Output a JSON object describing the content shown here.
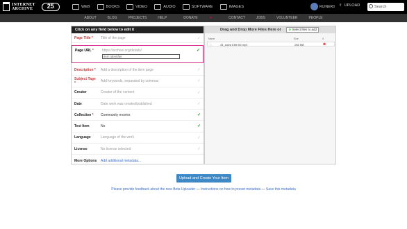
{
  "header": {
    "logo_line1": "INTERNET",
    "logo_line2": "ARCHIVE",
    "anniversary": "25",
    "media": [
      {
        "icon": "web-icon",
        "label": "WEB"
      },
      {
        "icon": "books-icon",
        "label": "BOOKS"
      },
      {
        "icon": "video-icon",
        "label": "VIDEO"
      },
      {
        "icon": "audio-icon",
        "label": "AUDIO"
      },
      {
        "icon": "software-icon",
        "label": "SOFTWARE"
      },
      {
        "icon": "images-icon",
        "label": "IMAGES"
      }
    ],
    "user": "RUINER0",
    "upload_label": "UPLOAD",
    "search_placeholder": "Search"
  },
  "subnav": [
    "ABOUT",
    "BLOG",
    "PROJECTS",
    "HELP",
    "DONATE",
    "CONTACT",
    "JOBS",
    "VOLUNTEER",
    "PEOPLE"
  ],
  "form": {
    "header": "Click on any field below to edit it",
    "title": {
      "label": "Page Title",
      "placeholder": "Title of the page"
    },
    "url": {
      "label": "Page URL",
      "prefix": "https://archive.org/details/",
      "placeholder": "item identifier"
    },
    "rows": [
      {
        "label": "Description",
        "value": "Add a description of the item page",
        "required": true,
        "set": false
      },
      {
        "label": "Subject Tags",
        "value": "Add keywords, separated by commas",
        "required": true,
        "set": false
      },
      {
        "label": "Creator",
        "value": "Creator of the content",
        "required": false,
        "set": false
      },
      {
        "label": "Date",
        "value": "Date work was created/published",
        "required": false,
        "set": false
      },
      {
        "label": "Collection",
        "value": "Community movies",
        "required": true,
        "set": true
      },
      {
        "label": "Test Item",
        "value": "No",
        "required": false,
        "set": true
      },
      {
        "label": "Language",
        "value": "Language of the work",
        "required": false,
        "set": false
      },
      {
        "label": "License",
        "value": "No license selected",
        "required": false,
        "set": false
      },
      {
        "label": "More Options",
        "value": "Add additional metadata...",
        "required": false,
        "set": false
      }
    ]
  },
  "files": {
    "dropzone": "Drag and Drop More Files Here or",
    "select_label": "Select files to add",
    "columns": {
      "name": "Name",
      "size": "Size",
      "x": "X"
    },
    "items": [
      {
        "name": "44_zalva Elite 69.mp4",
        "size": "286 MB"
      }
    ]
  },
  "actions": {
    "upload_button": "Upload and Create Your Item",
    "feedback": "Please provide feedback about the new Beta Uploader",
    "instructions": "Instructions on how to preset metadata",
    "save": "Save this metadata",
    "sep": "—"
  },
  "colors": {
    "accent": "#3d88c5",
    "highlight": "#d42b8a",
    "required": "#cc3333",
    "ok": "#33aa33"
  }
}
